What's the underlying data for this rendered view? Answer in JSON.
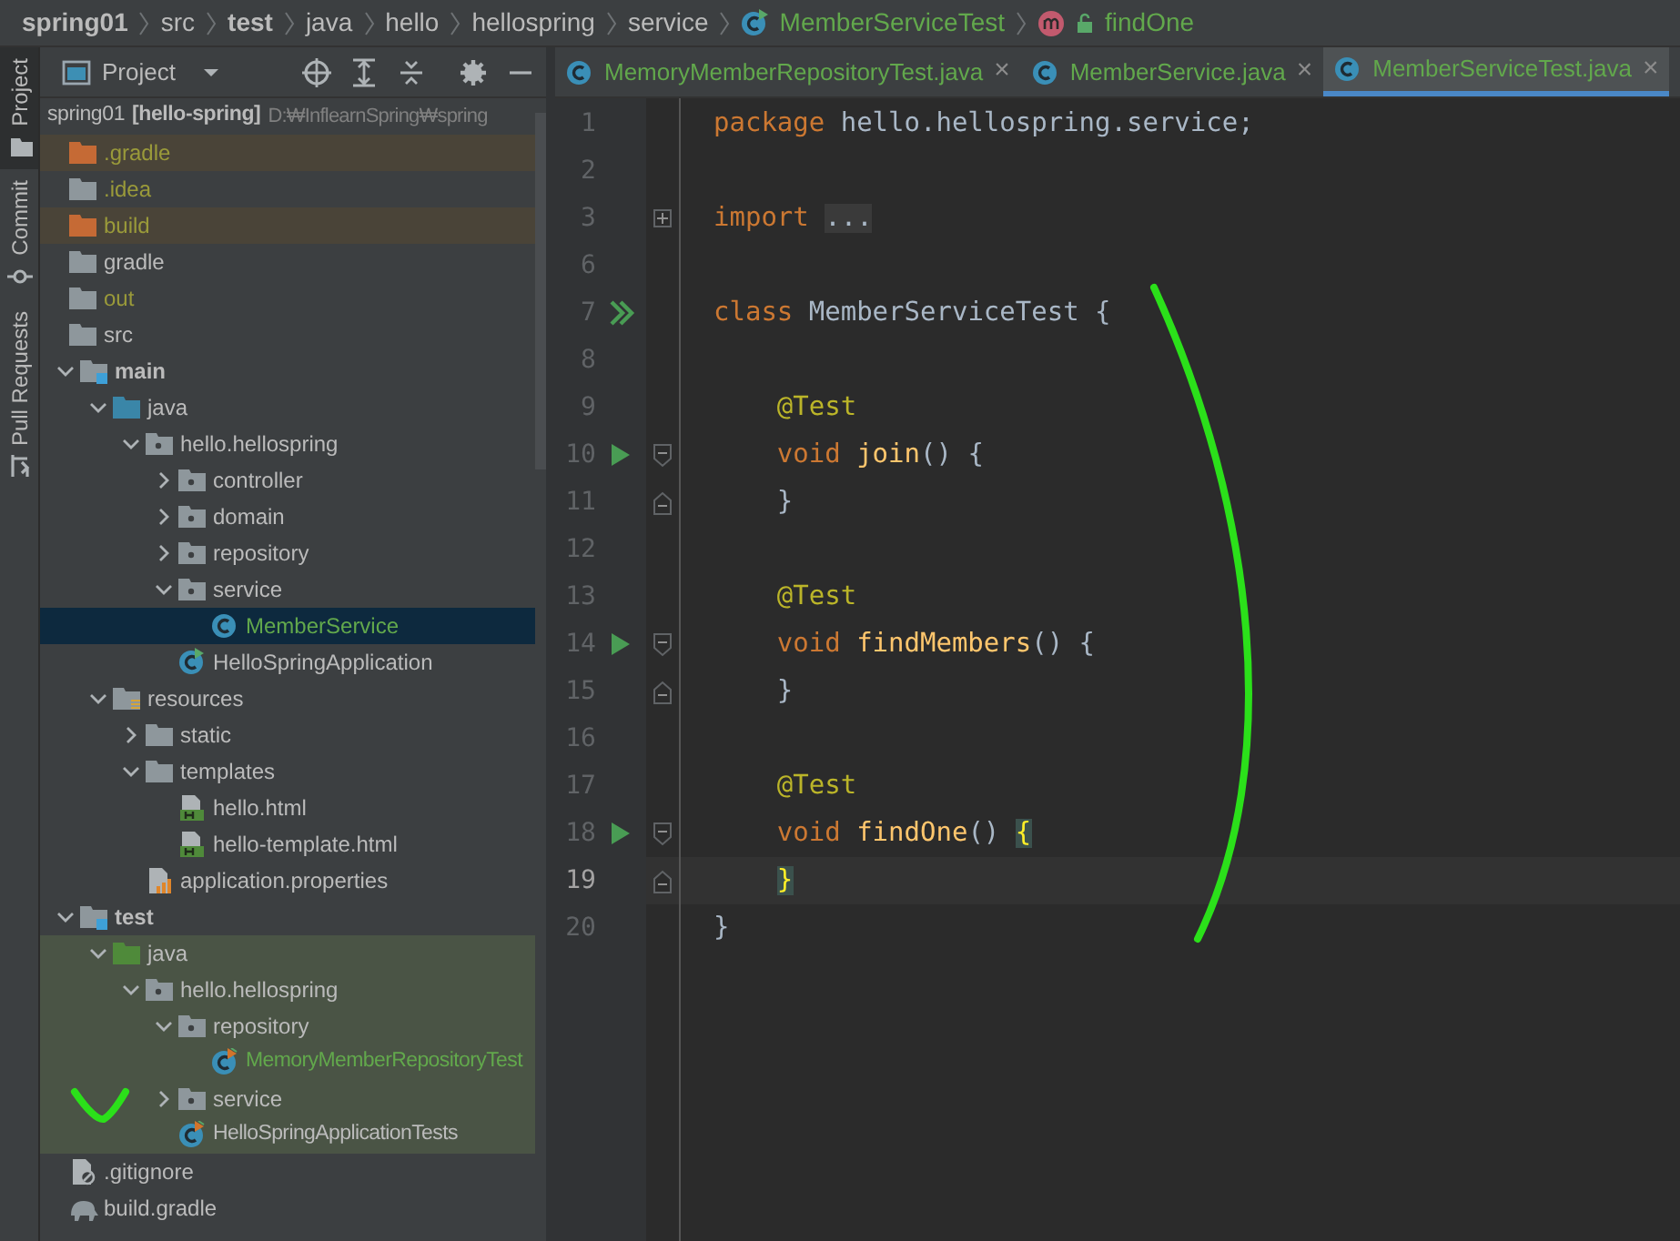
{
  "breadcrumbs": [
    {
      "label": "spring01",
      "bold": true,
      "kind": "folder",
      "color": "#bbbbbb"
    },
    {
      "label": "src",
      "bold": false,
      "kind": "folder",
      "color": "#bbbbbb"
    },
    {
      "label": "test",
      "bold": true,
      "kind": "folder",
      "color": "#bbbbbb"
    },
    {
      "label": "java",
      "bold": false,
      "kind": "folder",
      "color": "#bbbbbb"
    },
    {
      "label": "hello",
      "bold": false,
      "kind": "folder",
      "color": "#bbbbbb"
    },
    {
      "label": "hellospring",
      "bold": false,
      "kind": "folder",
      "color": "#bbbbbb"
    },
    {
      "label": "service",
      "bold": false,
      "kind": "folder",
      "color": "#bbbbbb"
    },
    {
      "label": "MemberServiceTest",
      "bold": false,
      "kind": "class",
      "color": "#62a84c"
    },
    {
      "label": "findOne",
      "bold": false,
      "kind": "method",
      "color": "#62a84c"
    }
  ],
  "tool_strip": [
    {
      "label": "Project",
      "selected": true,
      "kind": "project"
    },
    {
      "label": "Commit",
      "selected": false,
      "kind": "commit"
    },
    {
      "label": "Pull Requests",
      "selected": false,
      "kind": "pull-requests"
    }
  ],
  "project_panel": {
    "title": "Project",
    "root": {
      "name": "spring01",
      "module": "[hello-spring]",
      "path": "D:₩InflearnSpring₩spring"
    },
    "tree": [
      {
        "label": ".gradle",
        "kind": "folder-excluded",
        "color": "#9a9a3a",
        "excluded": true,
        "in_test_root": false,
        "selected": false
      },
      {
        "label": ".idea",
        "kind": "folder",
        "color": "#9a9a3a",
        "excluded": false,
        "in_test_root": false,
        "selected": false
      },
      {
        "label": "build",
        "kind": "folder-excluded",
        "color": "#9a9a3a",
        "excluded": true,
        "in_test_root": false,
        "selected": false
      },
      {
        "label": "gradle",
        "kind": "folder",
        "color": "#bbbbbb",
        "excluded": false,
        "in_test_root": false,
        "selected": false
      },
      {
        "label": "out",
        "kind": "folder",
        "color": "#9a9a3a",
        "excluded": false,
        "in_test_root": false,
        "selected": false
      },
      {
        "label": "src",
        "kind": "folder",
        "color": "#bbbbbb",
        "excluded": false,
        "in_test_root": false,
        "selected": false,
        "children": [
          {
            "label": "main",
            "kind": "module-folder",
            "color": "#bbbbbb",
            "excluded": false,
            "in_test_root": false,
            "selected": false,
            "expanded": true,
            "children": [
              {
                "label": "java",
                "kind": "source-folder",
                "color": "#bbbbbb",
                "excluded": false,
                "in_test_root": false,
                "selected": false,
                "expanded": true,
                "children": [
                  {
                    "label": "hello.hellospring",
                    "kind": "package",
                    "color": "#bbbbbb",
                    "excluded": false,
                    "in_test_root": false,
                    "selected": false,
                    "expanded": true,
                    "children": [
                      {
                        "label": "controller",
                        "kind": "package",
                        "color": "#bbbbbb",
                        "excluded": false,
                        "in_test_root": false,
                        "selected": false,
                        "expanded": false
                      },
                      {
                        "label": "domain",
                        "kind": "package",
                        "color": "#bbbbbb",
                        "excluded": false,
                        "in_test_root": false,
                        "selected": false,
                        "expanded": false
                      },
                      {
                        "label": "repository",
                        "kind": "package",
                        "color": "#bbbbbb",
                        "excluded": false,
                        "in_test_root": false,
                        "selected": false,
                        "expanded": false
                      },
                      {
                        "label": "service",
                        "kind": "package",
                        "color": "#bbbbbb",
                        "excluded": false,
                        "in_test_root": false,
                        "selected": false,
                        "expanded": true,
                        "children": [
                          {
                            "label": "MemberService",
                            "kind": "class",
                            "color": "#62a84c",
                            "excluded": false,
                            "in_test_root": false,
                            "selected": true
                          }
                        ]
                      },
                      {
                        "label": "HelloSpringApplication",
                        "kind": "spring-class",
                        "color": "#bbbbbb",
                        "excluded": false,
                        "in_test_root": false,
                        "selected": false
                      }
                    ]
                  }
                ]
              },
              {
                "label": "resources",
                "kind": "resources-folder",
                "color": "#bbbbbb",
                "excluded": false,
                "in_test_root": false,
                "selected": false,
                "expanded": true,
                "children": [
                  {
                    "label": "static",
                    "kind": "folder",
                    "color": "#bbbbbb",
                    "excluded": false,
                    "in_test_root": false,
                    "selected": false,
                    "expanded": false
                  },
                  {
                    "label": "templates",
                    "kind": "folder",
                    "color": "#bbbbbb",
                    "excluded": false,
                    "in_test_root": false,
                    "selected": false,
                    "expanded": true,
                    "children": [
                      {
                        "label": "hello.html",
                        "kind": "html",
                        "color": "#bbbbbb",
                        "excluded": false,
                        "in_test_root": false,
                        "selected": false
                      },
                      {
                        "label": "hello-template.html",
                        "kind": "html",
                        "color": "#bbbbbb",
                        "excluded": false,
                        "in_test_root": false,
                        "selected": false
                      }
                    ]
                  },
                  {
                    "label": "application.properties",
                    "kind": "properties",
                    "color": "#bbbbbb",
                    "excluded": false,
                    "in_test_root": false,
                    "selected": false
                  }
                ]
              }
            ]
          },
          {
            "label": "test",
            "kind": "module-folder",
            "color": "#bbbbbb",
            "excluded": false,
            "in_test_root": false,
            "selected": false,
            "expanded": true,
            "children": [
              {
                "label": "java",
                "kind": "test-folder",
                "color": "#bbbbbb",
                "excluded": false,
                "in_test_root": true,
                "selected": false,
                "expanded": true,
                "children": [
                  {
                    "label": "hello.hellospring",
                    "kind": "package",
                    "color": "#bbbbbb",
                    "excluded": false,
                    "in_test_root": true,
                    "selected": false,
                    "expanded": true,
                    "children": [
                      {
                        "label": "repository",
                        "kind": "package",
                        "color": "#bbbbbb",
                        "excluded": false,
                        "in_test_root": true,
                        "selected": false,
                        "expanded": true,
                        "children": [
                          {
                            "label": "MemoryMemberRepositoryTest",
                            "kind": "test-class",
                            "color": "#62a84c",
                            "excluded": false,
                            "in_test_root": true,
                            "selected": false
                          }
                        ]
                      },
                      {
                        "label": "service",
                        "kind": "package",
                        "color": "#bbbbbb",
                        "excluded": false,
                        "in_test_root": true,
                        "selected": false,
                        "expanded": false
                      },
                      {
                        "label": "HelloSpringApplicationTests",
                        "kind": "test-class",
                        "color": "#bbbbbb",
                        "excluded": false,
                        "in_test_root": true,
                        "selected": false
                      }
                    ]
                  }
                ]
              }
            ]
          }
        ]
      },
      {
        "label": ".gitignore",
        "kind": "ignore-file",
        "color": "#bbbbbb",
        "excluded": false,
        "in_test_root": false,
        "selected": false
      },
      {
        "label": "build.gradle",
        "kind": "gradle-file",
        "color": "#bbbbbb",
        "excluded": false,
        "in_test_root": false,
        "selected": false
      }
    ]
  },
  "tabs": [
    {
      "label": "MemoryMemberRepositoryTest.java",
      "close": "×",
      "selected": false,
      "color": "#62a84c"
    },
    {
      "label": "MemberService.java",
      "close": "×",
      "selected": false,
      "color": "#62a84c"
    },
    {
      "label": "MemberServiceTest.java",
      "close": "×",
      "selected": true,
      "color": "#62a84c"
    }
  ],
  "editor": {
    "lines": [
      {
        "number": "1",
        "kind": "plain",
        "current": false,
        "tokens": [
          {
            "kind": "keyword",
            "text": "package"
          },
          {
            "kind": "plain",
            "text": " hello.hellospring.service;"
          }
        ]
      },
      {
        "number": "2",
        "kind": "plain",
        "current": false
      },
      {
        "number": "3",
        "kind": "collapsed-import",
        "current": false,
        "tokens": [
          {
            "kind": "keyword",
            "text": "import "
          },
          {
            "kind": "folded",
            "text": "..."
          }
        ]
      },
      {
        "number": "6",
        "kind": "plain",
        "current": false
      },
      {
        "number": "7",
        "kind": "class-header",
        "current": false,
        "tokens": [
          {
            "kind": "keyword",
            "text": "class"
          },
          {
            "kind": "plain",
            "text": " MemberServiceTest {"
          }
        ]
      },
      {
        "number": "8",
        "kind": "plain",
        "current": false
      },
      {
        "number": "9",
        "kind": "plain",
        "current": false,
        "tokens": [
          {
            "kind": "annotation",
            "text": "    @Test"
          }
        ]
      },
      {
        "number": "10",
        "kind": "test-method",
        "current": false,
        "tokens": [
          {
            "kind": "keyword",
            "text": "    void "
          },
          {
            "kind": "method",
            "text": "join"
          },
          {
            "kind": "plain",
            "text": "() {"
          }
        ]
      },
      {
        "number": "11",
        "kind": "block-end",
        "current": false,
        "tokens": [
          {
            "kind": "plain",
            "text": "    }"
          }
        ]
      },
      {
        "number": "12",
        "kind": "plain",
        "current": false
      },
      {
        "number": "13",
        "kind": "plain",
        "current": false,
        "tokens": [
          {
            "kind": "annotation",
            "text": "    @Test"
          }
        ]
      },
      {
        "number": "14",
        "kind": "test-method",
        "current": false,
        "tokens": [
          {
            "kind": "keyword",
            "text": "    void "
          },
          {
            "kind": "method",
            "text": "findMembers"
          },
          {
            "kind": "plain",
            "text": "() {"
          }
        ]
      },
      {
        "number": "15",
        "kind": "block-end",
        "current": false,
        "tokens": [
          {
            "kind": "plain",
            "text": "    }"
          }
        ]
      },
      {
        "number": "16",
        "kind": "plain",
        "current": false
      },
      {
        "number": "17",
        "kind": "plain",
        "current": false,
        "tokens": [
          {
            "kind": "annotation",
            "text": "    @Test"
          }
        ]
      },
      {
        "number": "18",
        "kind": "test-method",
        "current": false,
        "tokens": [
          {
            "kind": "keyword",
            "text": "    void "
          },
          {
            "kind": "method",
            "text": "findOne"
          },
          {
            "kind": "plain",
            "text": "() "
          },
          {
            "kind": "brace-match",
            "text": "{"
          }
        ]
      },
      {
        "number": "19",
        "kind": "block-end",
        "current": true,
        "tokens": [
          {
            "kind": "brace-match",
            "text": "    }"
          }
        ]
      },
      {
        "number": "20",
        "kind": "plain",
        "current": false,
        "tokens": [
          {
            "kind": "plain",
            "text": "}"
          }
        ]
      }
    ]
  }
}
